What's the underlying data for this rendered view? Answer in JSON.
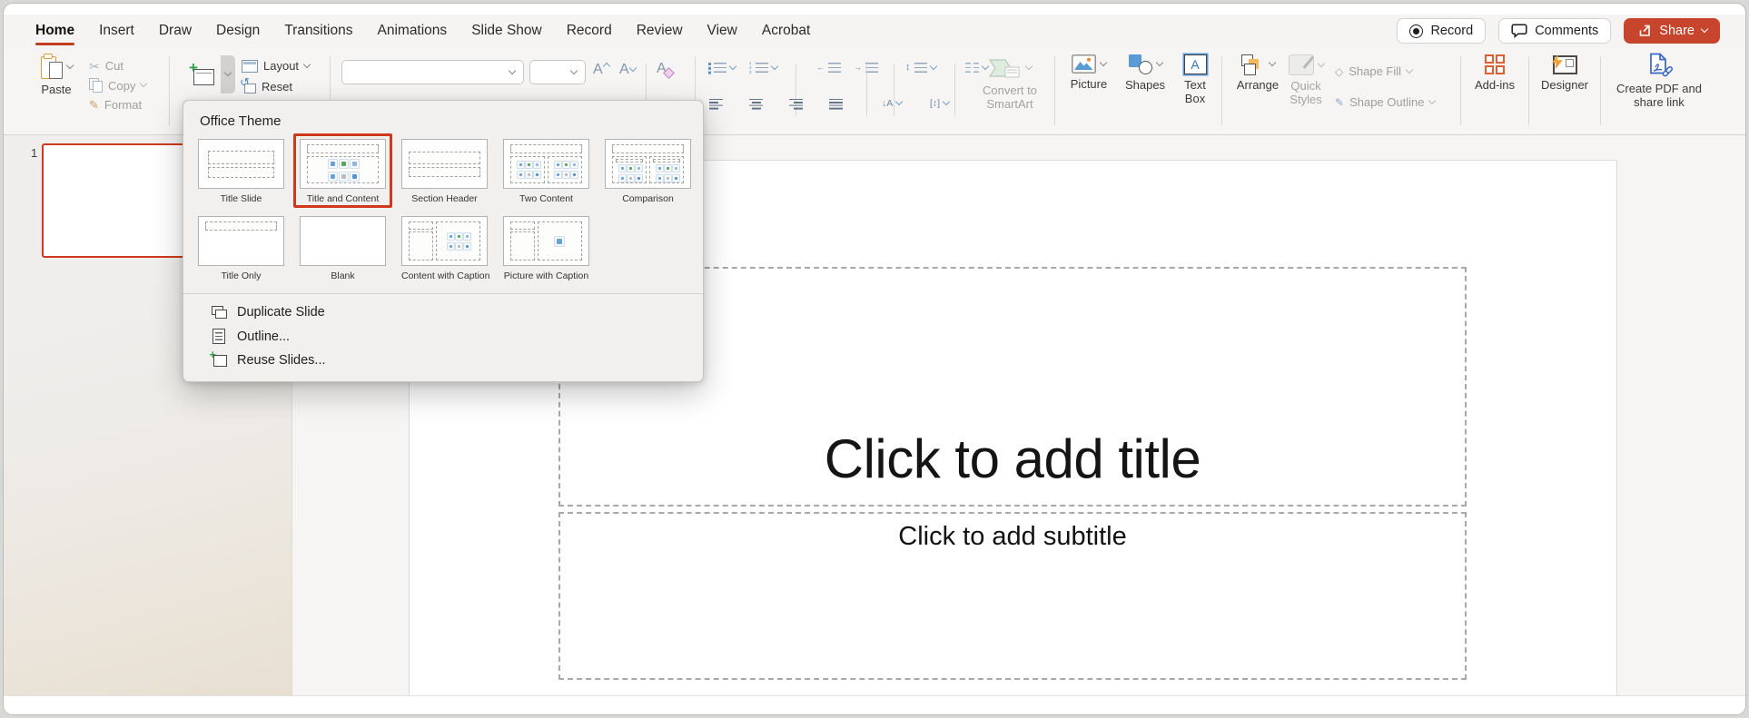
{
  "tabs": {
    "items": [
      {
        "label": "Home",
        "active": true
      },
      {
        "label": "Insert",
        "active": false
      },
      {
        "label": "Draw",
        "active": false
      },
      {
        "label": "Design",
        "active": false
      },
      {
        "label": "Transitions",
        "active": false
      },
      {
        "label": "Animations",
        "active": false
      },
      {
        "label": "Slide Show",
        "active": false
      },
      {
        "label": "Record",
        "active": false
      },
      {
        "label": "Review",
        "active": false
      },
      {
        "label": "View",
        "active": false
      },
      {
        "label": "Acrobat",
        "active": false
      }
    ]
  },
  "window_actions": {
    "record": "Record",
    "comments": "Comments",
    "share": "Share"
  },
  "ribbon": {
    "paste": "Paste",
    "cut": "Cut",
    "copy": "Copy",
    "format": "Format",
    "layout": "Layout",
    "reset": "Reset",
    "convert_smartart": "Convert to SmartArt",
    "picture": "Picture",
    "shapes": "Shapes",
    "text_box": "Text Box",
    "arrange": "Arrange",
    "quick_styles": "Quick Styles",
    "shape_fill": "Shape Fill",
    "shape_outline": "Shape Outline",
    "addins": "Add-ins",
    "designer": "Designer",
    "create_pdf": "Create PDF and share link"
  },
  "layout_menu": {
    "header": "Office Theme",
    "layouts": [
      {
        "label": "Title Slide",
        "type": "title-slide",
        "selected": false
      },
      {
        "label": "Title and Content",
        "type": "title-content",
        "selected": true
      },
      {
        "label": "Section Header",
        "type": "section-header",
        "selected": false
      },
      {
        "label": "Two Content",
        "type": "two-content",
        "selected": false
      },
      {
        "label": "Comparison",
        "type": "comparison",
        "selected": false
      },
      {
        "label": "Title Only",
        "type": "title-only",
        "selected": false
      },
      {
        "label": "Blank",
        "type": "blank",
        "selected": false
      },
      {
        "label": "Content with Caption",
        "type": "content-caption",
        "selected": false
      },
      {
        "label": "Picture with Caption",
        "type": "picture-caption",
        "selected": false
      }
    ],
    "commands": [
      {
        "label": "Duplicate Slide",
        "icon": "duplicate-slide-icon"
      },
      {
        "label": "Outline...",
        "icon": "outline-icon"
      },
      {
        "label": "Reuse Slides...",
        "icon": "reuse-slides-icon"
      }
    ]
  },
  "thumbnail_panel": {
    "slide_number": "1"
  },
  "slide": {
    "title_placeholder": "Click to add title",
    "subtitle_placeholder": "Click to add subtitle"
  },
  "colors": {
    "accent_share": "#c7452c",
    "home_underline": "#c23d20",
    "selection_red": "#cf3a1d"
  }
}
